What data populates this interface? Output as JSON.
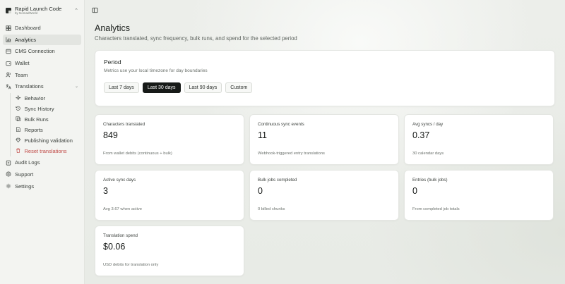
{
  "brand": {
    "title": "Rapid Launch Code",
    "subtitle": "by NomadWorld"
  },
  "nav": {
    "dashboard": "Dashboard",
    "analytics": "Analytics",
    "cms": "CMS Connection",
    "wallet": "Wallet",
    "team": "Team",
    "translations": "Translations",
    "sub": {
      "behavior": "Behavior",
      "sync_history": "Sync History",
      "bulk_runs": "Bulk Runs",
      "reports": "Reports",
      "publishing": "Publishing validation",
      "reset": "Reset translations"
    },
    "audit": "Audit Logs",
    "support": "Support",
    "settings": "Settings"
  },
  "page": {
    "title": "Analytics",
    "subtitle": "Characters translated, sync frequency, bulk runs, and spend for the selected period"
  },
  "period": {
    "title": "Period",
    "subtitle": "Metrics use your local timezone for day boundaries",
    "buttons": [
      "Last 7 days",
      "Last 30 days",
      "Last 90 days",
      "Custom"
    ],
    "selected": "Last 30 days"
  },
  "metrics": [
    {
      "label": "Characters translated",
      "value": "849",
      "note": "From wallet debits (continuous + bulk)"
    },
    {
      "label": "Continuous sync events",
      "value": "11",
      "note": "Webhook-triggered entry translations"
    },
    {
      "label": "Avg syncs / day",
      "value": "0.37",
      "note": "30 calendar days"
    },
    {
      "label": "Active sync days",
      "value": "3",
      "note": "Avg 3.67 when active"
    },
    {
      "label": "Bulk jobs completed",
      "value": "0",
      "note": "0 billed chunks"
    },
    {
      "label": "Entries (bulk jobs)",
      "value": "0",
      "note": "From completed job totals"
    },
    {
      "label": "Translation spend",
      "value": "$0.06",
      "note": "USD debits for translation only"
    }
  ],
  "colors": {
    "active_button": "#171a18",
    "danger": "#c04a47",
    "sidebar_active": "#e3e5e1"
  }
}
